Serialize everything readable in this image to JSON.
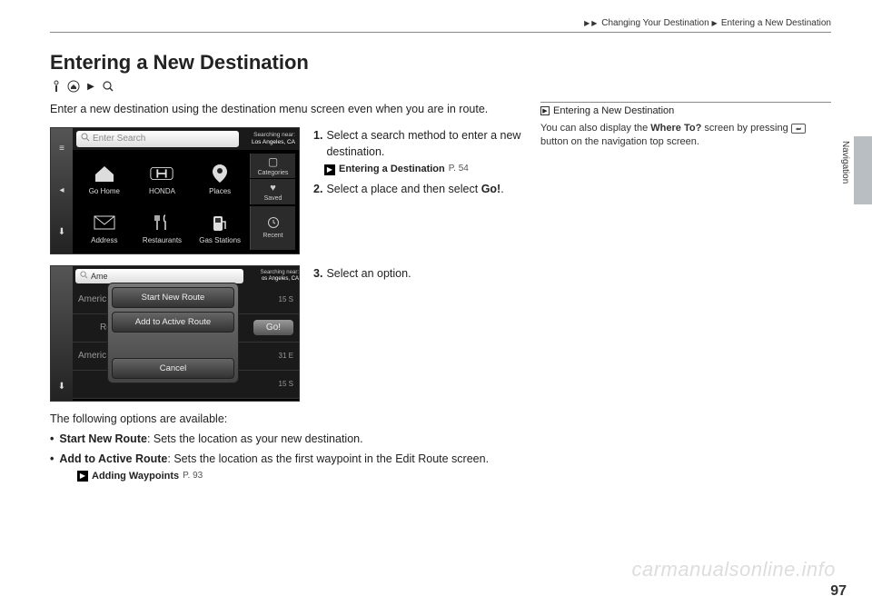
{
  "header": {
    "breadcrumb1": "Changing Your Destination",
    "breadcrumb2": "Entering a New Destination"
  },
  "title": "Entering a New Destination",
  "intro": "Enter a new destination using the destination menu screen even when you are in route.",
  "screenshot1": {
    "search_placeholder": "Enter Search",
    "searching_label": "Searching near:",
    "searching_location": "Los Angeles, CA",
    "tiles": {
      "go_home": "Go Home",
      "honda": "HONDA",
      "places": "Places",
      "address": "Address",
      "restaurants": "Restaurants",
      "gas": "Gas Stations"
    },
    "side": {
      "categories": "Categories",
      "saved": "Saved",
      "recent": "Recent"
    }
  },
  "steps": {
    "s1": "Select a search method to enter a new destination.",
    "s1_ref_label": "Entering a Destination",
    "s1_ref_page": "P. 54",
    "s2_a": "Select a place and then select ",
    "s2_b": "Go!",
    "s2_c": ".",
    "s3": "Select an option."
  },
  "screenshot2": {
    "search_text": "Ame",
    "searching_label": "Searching near:",
    "searching_location": "os Angeles, CA",
    "row1": "Americ",
    "row1_dist": "15   S",
    "row2": "Rou",
    "go_label": "Go!",
    "row3": "Americ",
    "row3_dist": "31   E",
    "row4_dist": "15   S",
    "popup": {
      "start": "Start New Route",
      "add": "Add to Active Route",
      "cancel": "Cancel"
    }
  },
  "options_intro": "The following options are available:",
  "option1_label": "Start New Route",
  "option1_text": ": Sets the location as your new destination.",
  "option2_label": "Add to Active Route",
  "option2_text": ": Sets the location as the first waypoint in the Edit Route screen.",
  "option2_ref_label": "Adding Waypoints",
  "option2_ref_page": "P. 93",
  "note": {
    "title": "Entering a New Destination",
    "text_a": "You can also display the ",
    "text_b": "Where To?",
    "text_c": " screen by pressing ",
    "text_d": " button on the navigation top screen."
  },
  "side_label": "Navigation",
  "page_number": "97",
  "watermark": "carmanualsonline.info"
}
